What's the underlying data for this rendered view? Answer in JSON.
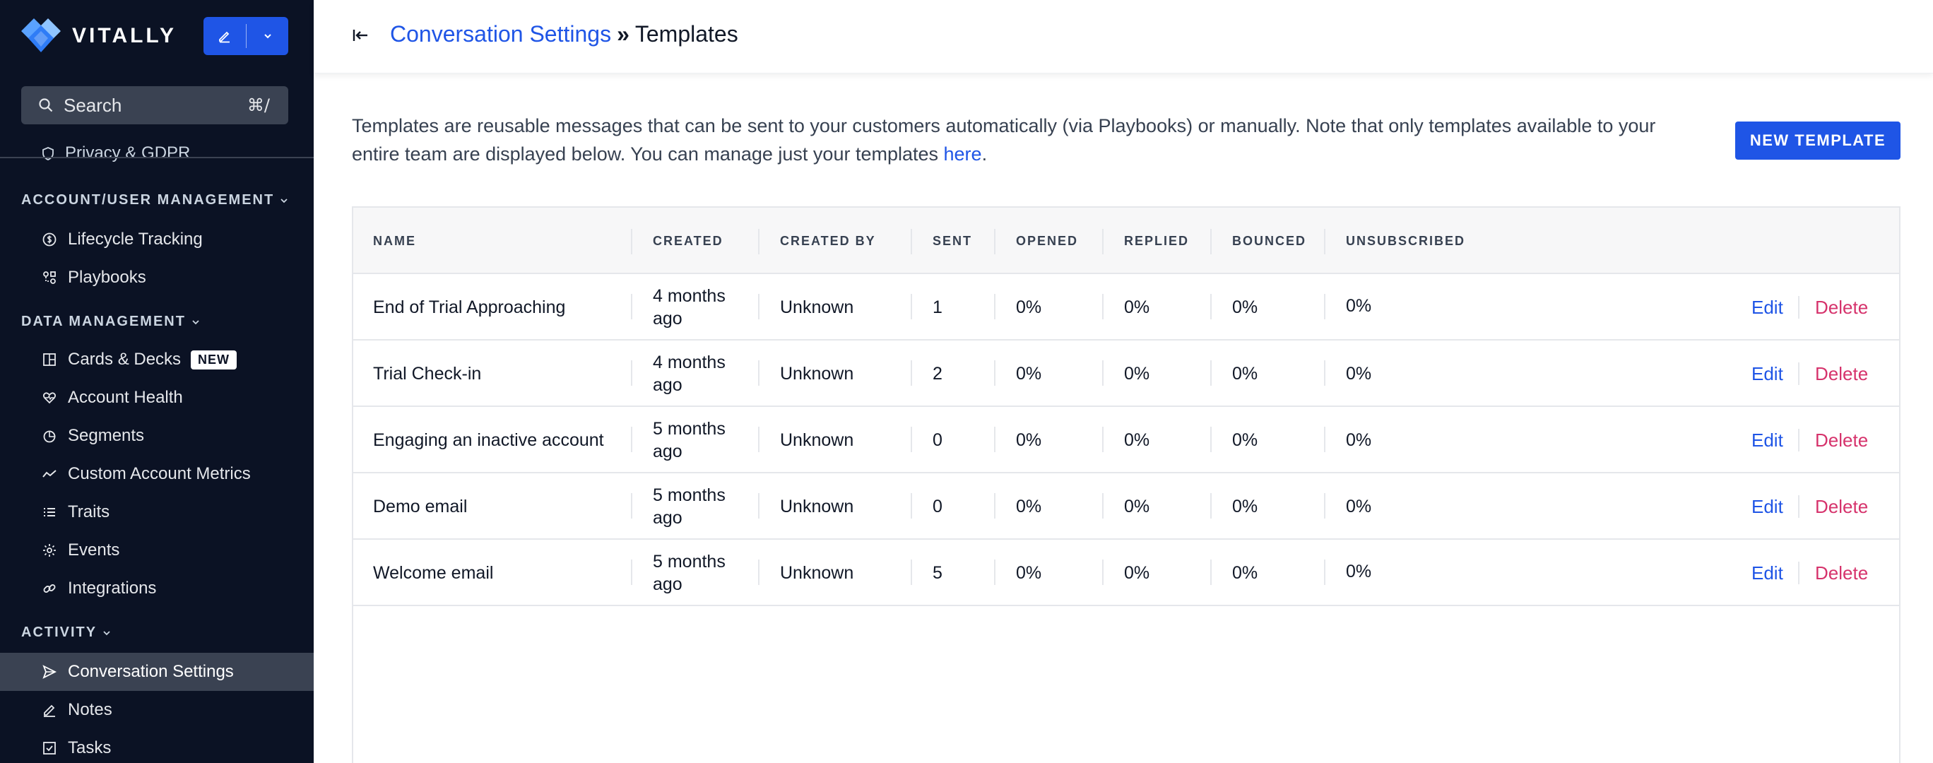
{
  "brand": {
    "name": "VITALLY",
    "accent": "#1f55e6"
  },
  "search": {
    "label": "Search",
    "shortcut": "⌘/"
  },
  "sidebar": {
    "partial_item": "Privacy & GDPR",
    "sections": [
      {
        "label": "ACCOUNT/USER MANAGEMENT",
        "items": [
          {
            "label": "Lifecycle Tracking",
            "icon": "dollar-circle-icon"
          },
          {
            "label": "Playbooks",
            "icon": "playbook-icon"
          }
        ]
      },
      {
        "label": "DATA MANAGEMENT",
        "items": [
          {
            "label": "Cards & Decks",
            "icon": "grid-icon",
            "badge": "NEW"
          },
          {
            "label": "Account Health",
            "icon": "heart-icon"
          },
          {
            "label": "Segments",
            "icon": "pie-icon"
          },
          {
            "label": "Custom Account Metrics",
            "icon": "trend-icon"
          },
          {
            "label": "Traits",
            "icon": "list-icon"
          },
          {
            "label": "Events",
            "icon": "sparkle-icon"
          },
          {
            "label": "Integrations",
            "icon": "link-icon"
          }
        ]
      },
      {
        "label": "ACTIVITY",
        "items": [
          {
            "label": "Conversation Settings",
            "icon": "send-icon",
            "active": true
          },
          {
            "label": "Notes",
            "icon": "pen-icon"
          },
          {
            "label": "Tasks",
            "icon": "checkbox-icon"
          }
        ]
      }
    ]
  },
  "header": {
    "breadcrumb_link": "Conversation Settings",
    "breadcrumb_sep": "»",
    "breadcrumb_current": "Templates"
  },
  "main": {
    "description_before": "Templates are reusable messages that can be sent to your customers automatically (via Playbooks) or manually. Note that only templates available to your entire team are displayed below. You can manage just your templates ",
    "description_link": "here",
    "description_after": ".",
    "new_template_label": "NEW TEMPLATE"
  },
  "table": {
    "columns": [
      "NAME",
      "CREATED",
      "CREATED BY",
      "SENT",
      "OPENED",
      "REPLIED",
      "BOUNCED",
      "UNSUBSCRIBED"
    ],
    "rows": [
      {
        "name": "End of Trial Approaching",
        "created": "4 months ago",
        "created_by": "Unknown",
        "sent": "1",
        "opened": "0%",
        "replied": "0%",
        "bounced": "0%",
        "unsubscribed": "0%"
      },
      {
        "name": "Trial Check-in",
        "created": "4 months ago",
        "created_by": "Unknown",
        "sent": "2",
        "opened": "0%",
        "replied": "0%",
        "bounced": "0%",
        "unsubscribed": "0%"
      },
      {
        "name": "Engaging an inactive account",
        "created": "5 months ago",
        "created_by": "Unknown",
        "sent": "0",
        "opened": "0%",
        "replied": "0%",
        "bounced": "0%",
        "unsubscribed": "0%"
      },
      {
        "name": "Demo email",
        "created": "5 months ago",
        "created_by": "Unknown",
        "sent": "0",
        "opened": "0%",
        "replied": "0%",
        "bounced": "0%",
        "unsubscribed": "0%"
      },
      {
        "name": "Welcome email",
        "created": "5 months ago",
        "created_by": "Unknown",
        "sent": "5",
        "opened": "0%",
        "replied": "0%",
        "bounced": "0%",
        "unsubscribed": "0%"
      }
    ],
    "edit_label": "Edit",
    "delete_label": "Delete"
  }
}
